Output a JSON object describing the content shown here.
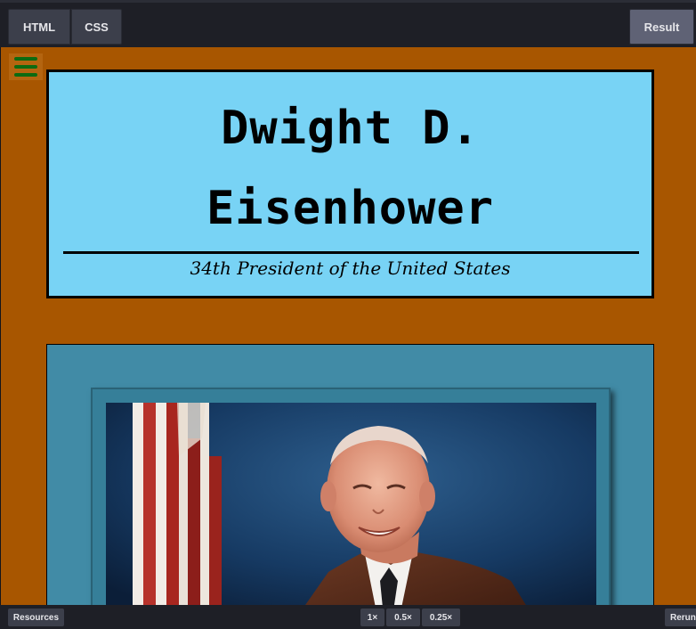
{
  "editor": {
    "tabs": {
      "html": "HTML",
      "css": "CSS",
      "result": "Result"
    },
    "bottom": {
      "resources": "Resources",
      "zoom": [
        "1×",
        "0.5×",
        "0.25×"
      ],
      "rerun": "Rerun"
    }
  },
  "page": {
    "title_line1": "Dwight D.",
    "title_line2": "Eisenhower",
    "subtitle": "34th President of the United States"
  },
  "colors": {
    "page_background": "#a85600",
    "title_card": "#78d3f5",
    "photo_card": "#418ba6",
    "menu_icon": "#0d6b11"
  },
  "icons": {
    "menu": "hamburger-menu-icon"
  }
}
